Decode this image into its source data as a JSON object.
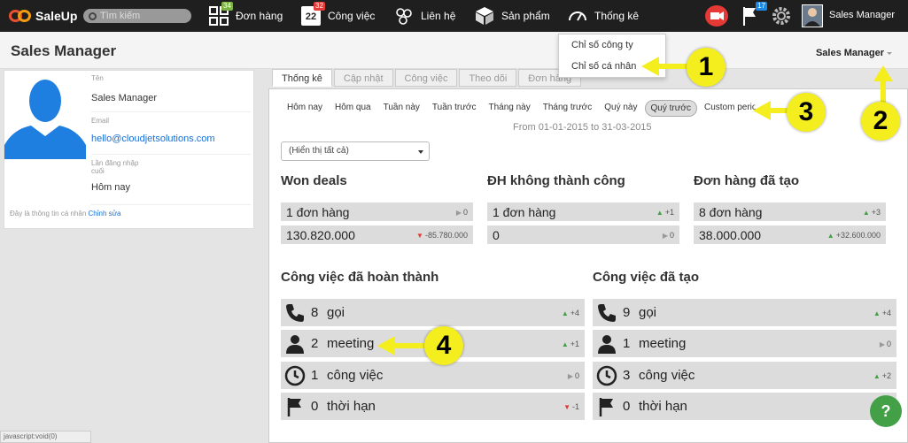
{
  "app": {
    "name": "SaleUp"
  },
  "search": {
    "placeholder": "Tìm kiếm"
  },
  "nav": {
    "orders": {
      "label": "Đơn hàng",
      "badge": "34"
    },
    "tasks": {
      "label": "Công việc",
      "badge": "32",
      "day": "22"
    },
    "contacts": {
      "label": "Liên hệ"
    },
    "products": {
      "label": "Sản phẩm"
    },
    "stats": {
      "label": "Thống kê"
    },
    "flag_badge": "17",
    "user": "Sales Manager"
  },
  "dropdown": {
    "items": [
      "Chỉ số công ty",
      "Chỉ số cá nhân"
    ]
  },
  "header": {
    "title": "Sales Manager",
    "user_menu": "Sales Manager"
  },
  "profile": {
    "name_label": "Tên",
    "name": "Sales Manager",
    "email_label": "Email",
    "email": "hello@cloudjetsolutions.com",
    "login_label": "Lần đăng nhập cuối",
    "login": "Hôm nay",
    "footer": "Đây là thông tin cá nhân",
    "edit_link": "Chỉnh sửa"
  },
  "tabs": [
    "Thống kê",
    "Cập nhật",
    "Công việc",
    "Theo dõi",
    "Đơn hàng"
  ],
  "periods": [
    "Hôm nay",
    "Hôm qua",
    "Tuần này",
    "Tuần trước",
    "Tháng này",
    "Tháng trước",
    "Quý này",
    "Quý trước",
    "Custom period"
  ],
  "date_range": "From 01-01-2015 to 31-03-2015",
  "filter": {
    "value": "(Hiển thị tất cả)"
  },
  "kpis": [
    {
      "title": "Won deals",
      "count": "1 đơn hàng",
      "count_delta": "0",
      "count_dir": "flat",
      "amount": "130.820.000",
      "amount_delta": "-85.780.000",
      "amount_dir": "down"
    },
    {
      "title": "ĐH không thành công",
      "count": "1 đơn hàng",
      "count_delta": "+1",
      "count_dir": "up",
      "amount": "0",
      "amount_delta": "0",
      "amount_dir": "flat"
    },
    {
      "title": "Đơn hàng đã tạo",
      "count": "8 đơn hàng",
      "count_delta": "+3",
      "count_dir": "up",
      "amount": "38.000.000",
      "amount_delta": "+32.600.000",
      "amount_dir": "up"
    }
  ],
  "completed": {
    "title": "Công việc đã hoàn thành",
    "rows": [
      {
        "icon": "phone-icon",
        "count": "8",
        "label": "gọi",
        "delta": "+4",
        "dir": "up"
      },
      {
        "icon": "person-icon",
        "count": "2",
        "label": "meeting",
        "delta": "+1",
        "dir": "up"
      },
      {
        "icon": "clock-icon",
        "count": "1",
        "label": "công việc",
        "delta": "0",
        "dir": "flat"
      },
      {
        "icon": "flag-icon",
        "count": "0",
        "label": "thời hạn",
        "delta": "-1",
        "dir": "down"
      }
    ]
  },
  "created": {
    "title": "Công việc đã tạo",
    "rows": [
      {
        "icon": "phone-icon",
        "count": "9",
        "label": "gọi",
        "delta": "+4",
        "dir": "up"
      },
      {
        "icon": "person-icon",
        "count": "1",
        "label": "meeting",
        "delta": "0",
        "dir": "flat"
      },
      {
        "icon": "clock-icon",
        "count": "3",
        "label": "công việc",
        "delta": "+2",
        "dir": "up"
      },
      {
        "icon": "flag-icon",
        "count": "0",
        "label": "thời hạn",
        "delta": "",
        "dir": ""
      }
    ]
  },
  "callouts": [
    "1",
    "2",
    "3",
    "4"
  ],
  "status_bar": "javascript:void(0)",
  "colors": {
    "callout": "#f4ee1e",
    "nav_bg": "#1f1f1f",
    "link": "#1a6fd1",
    "up": "#43a047",
    "down": "#e53935"
  }
}
